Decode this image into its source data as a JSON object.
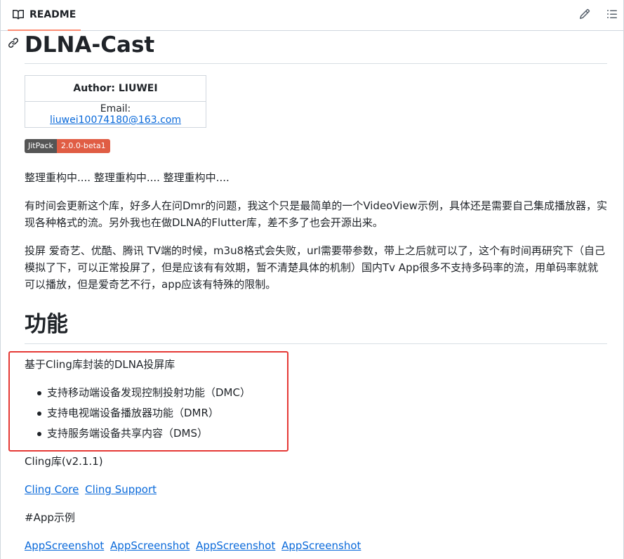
{
  "header": {
    "tab_label": "README",
    "edit_icon": "pencil-icon",
    "toc_icon": "list-icon"
  },
  "readme": {
    "title": "DLNA-Cast",
    "author_label": "Author: LIUWEI",
    "email_label": "Email:",
    "email": "liuwei10074180@163.com",
    "badge_left": "JitPack",
    "badge_right": "2.0.0-beta1",
    "para1": "整理重构中.... 整理重构中.... 整理重构中....",
    "para2": "有时间会更新这个库，好多人在问Dmr的问题，我这个只是最简单的一个VideoView示例，具体还是需要自己集成播放器，实现各种格式的流。另外我也在做DLNA的Flutter库，差不多了也会开源出来。",
    "para3": "投屏 爱奇艺、优酷、腾讯 TV端的时候，m3u8格式会失败，url需要带参数，带上之后就可以了，这个有时间再研究下（自己模拟了下，可以正常投屏了，但是应该有有效期，暂不清楚具体的机制）国内Tv App很多不支持多码率的流，用单码率就就可以播放，但是爱奇艺不行，app应该有特殊的限制。",
    "section_title": "功能",
    "feature_intro": "基于Cling库封装的DLNA投屏库",
    "features": [
      "支持移动端设备发现控制投射功能（DMC）",
      "支持电视端设备播放器功能（DMR）",
      "支持服务端设备共享内容（DMS）"
    ],
    "cling_version": "Cling库(v2.1.1)",
    "links": [
      "Cling Core",
      "Cling Support"
    ],
    "app_heading": "#App示例",
    "screenshots": [
      "AppScreenshot",
      "AppScreenshot",
      "AppScreenshot",
      "AppScreenshot"
    ]
  },
  "colors": {
    "link": "#0969da",
    "highlight_border": "#e53935",
    "tab_underline": "#fd8c73"
  }
}
